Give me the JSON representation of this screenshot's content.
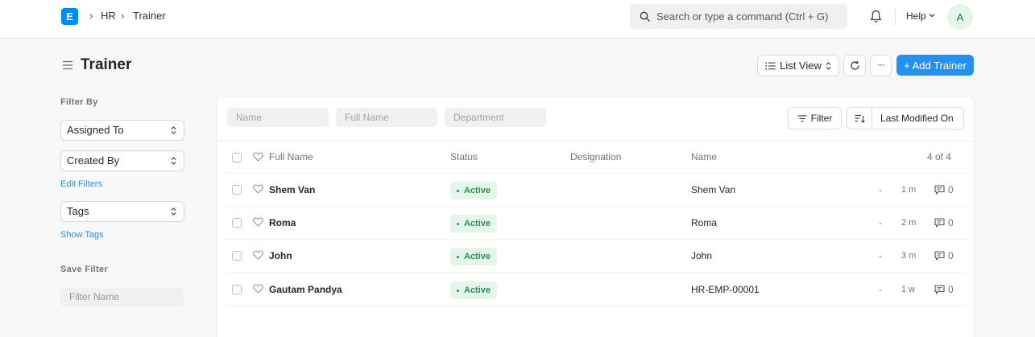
{
  "navbar": {
    "logo_letter": "E",
    "breadcrumbs": [
      "HR",
      "Trainer"
    ],
    "search_placeholder": "Search or type a command (Ctrl + G)",
    "help_label": "Help",
    "avatar_initial": "A"
  },
  "page": {
    "title": "Trainer",
    "list_view_label": "List View",
    "more_label": "···",
    "add_button_label": "+ Add Trainer"
  },
  "sidebar": {
    "filter_by_label": "Filter By",
    "assigned_to_label": "Assigned To",
    "created_by_label": "Created By",
    "edit_filters_label": "Edit Filters",
    "tags_label": "Tags",
    "show_tags_label": "Show Tags",
    "save_filter_label": "Save Filter",
    "filter_name_placeholder": "Filter Name"
  },
  "list": {
    "filters": {
      "name_placeholder": "Name",
      "full_name_placeholder": "Full Name",
      "department_placeholder": "Department",
      "filter_button_label": "Filter",
      "sort_label": "Last Modified On"
    },
    "columns": {
      "full_name": "Full Name",
      "status": "Status",
      "designation": "Designation",
      "name": "Name",
      "count": "4 of 4"
    },
    "rows": [
      {
        "full_name": "Shem Van",
        "status": "Active",
        "designation": "",
        "name": "Shem Van",
        "dash": "-",
        "modified": "1 m",
        "comments": "0"
      },
      {
        "full_name": "Roma",
        "status": "Active",
        "designation": "",
        "name": "Roma",
        "dash": "-",
        "modified": "2 m",
        "comments": "0"
      },
      {
        "full_name": "John",
        "status": "Active",
        "designation": "",
        "name": "John",
        "dash": "-",
        "modified": "3 m",
        "comments": "0"
      },
      {
        "full_name": "Gautam Pandya",
        "status": "Active",
        "designation": "",
        "name": "HR-EMP-00001",
        "dash": "-",
        "modified": "1 w",
        "comments": "0"
      }
    ]
  },
  "colors": {
    "primary": "#2490ef",
    "logo": "#0089ff",
    "active_badge_bg": "#e4f5e9",
    "active_badge_text": "#278f5e"
  }
}
